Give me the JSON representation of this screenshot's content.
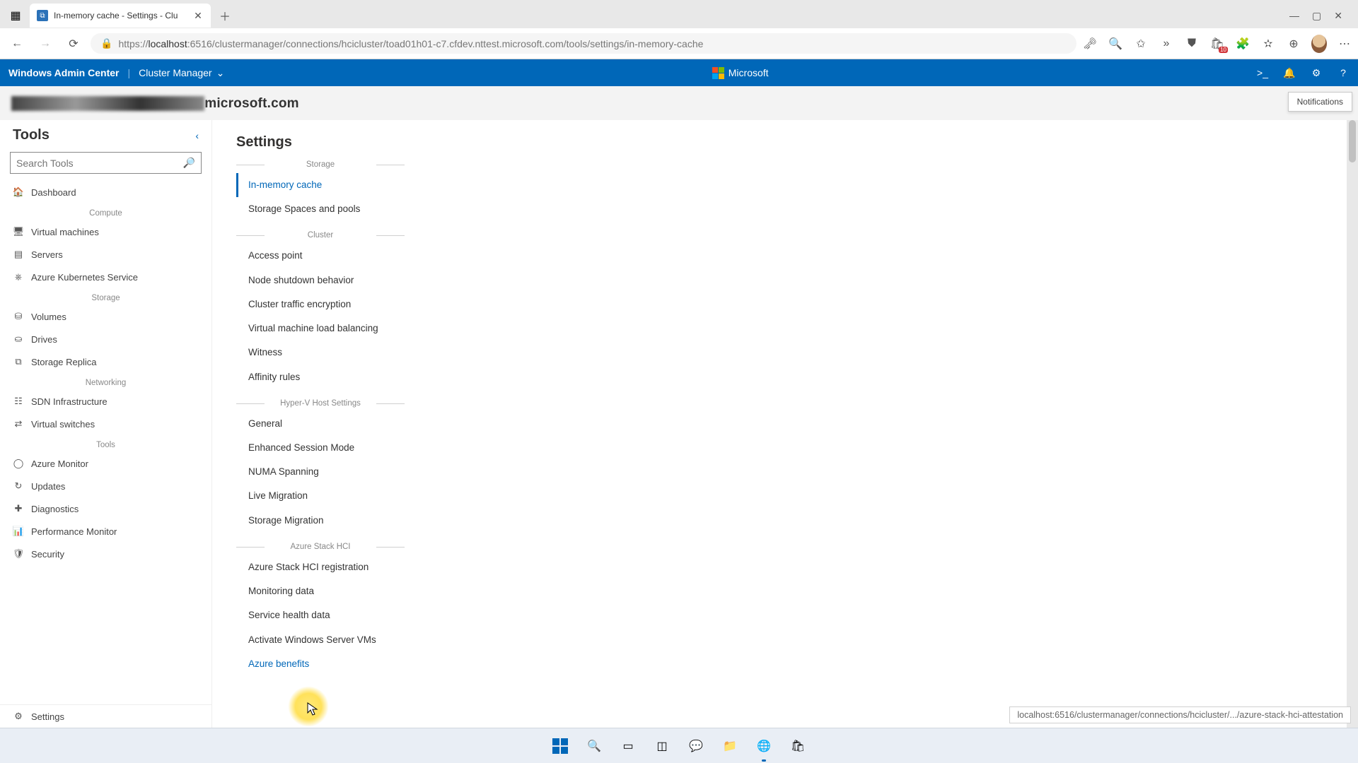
{
  "browser": {
    "tab_title": "In-memory cache - Settings - Clu",
    "url_prefix": "https://",
    "url_host": "localhost",
    "url_port": ":6516",
    "url_path": "/clustermanager/connections/hcicluster/toad01h01-c7.cfdev.nttest.microsoft.com/tools/settings/in-memory-cache",
    "collections_badge": "10"
  },
  "wac": {
    "brand": "Windows Admin Center",
    "context": "Cluster Manager",
    "ms_label": "Microsoft",
    "notif_tooltip": "Notifications"
  },
  "hostname_suffix": "microsoft.com",
  "tools": {
    "title": "Tools",
    "search_placeholder": "Search Tools",
    "groups": [
      {
        "name": "",
        "items": [
          {
            "icon": "🏠",
            "label": "Dashboard",
            "iconName": "home-icon",
            "itemName": "tool-dashboard"
          }
        ]
      },
      {
        "name": "Compute",
        "items": [
          {
            "icon": "🖥",
            "label": "Virtual machines",
            "iconName": "vm-icon",
            "itemName": "tool-virtual-machines"
          },
          {
            "icon": "▤",
            "label": "Servers",
            "iconName": "server-icon",
            "itemName": "tool-servers"
          },
          {
            "icon": "⎈",
            "label": "Azure Kubernetes Service",
            "iconName": "aks-icon",
            "itemName": "tool-aks"
          }
        ]
      },
      {
        "name": "Storage",
        "items": [
          {
            "icon": "⛁",
            "label": "Volumes",
            "iconName": "volume-icon",
            "itemName": "tool-volumes"
          },
          {
            "icon": "⛀",
            "label": "Drives",
            "iconName": "drive-icon",
            "itemName": "tool-drives"
          },
          {
            "icon": "⧉",
            "label": "Storage Replica",
            "iconName": "replica-icon",
            "itemName": "tool-storage-replica"
          }
        ]
      },
      {
        "name": "Networking",
        "items": [
          {
            "icon": "☷",
            "label": "SDN Infrastructure",
            "iconName": "sdn-icon",
            "itemName": "tool-sdn"
          },
          {
            "icon": "⇄",
            "label": "Virtual switches",
            "iconName": "vswitch-icon",
            "itemName": "tool-virtual-switches"
          }
        ]
      },
      {
        "name": "Tools",
        "items": [
          {
            "icon": "◯",
            "label": "Azure Monitor",
            "iconName": "monitor-icon",
            "itemName": "tool-azure-monitor"
          },
          {
            "icon": "↻",
            "label": "Updates",
            "iconName": "updates-icon",
            "itemName": "tool-updates"
          },
          {
            "icon": "✚",
            "label": "Diagnostics",
            "iconName": "diag-icon",
            "itemName": "tool-diagnostics"
          },
          {
            "icon": "📊",
            "label": "Performance Monitor",
            "iconName": "perf-icon",
            "itemName": "tool-perf-monitor"
          },
          {
            "icon": "🛡",
            "label": "Security",
            "iconName": "shield-icon",
            "itemName": "tool-security"
          }
        ]
      }
    ],
    "bottom": {
      "icon": "⚙",
      "label": "Settings",
      "iconName": "gear-icon",
      "itemName": "tool-settings"
    }
  },
  "settings": {
    "title": "Settings",
    "sections": [
      {
        "name": "Storage",
        "items": [
          {
            "label": "In-memory cache",
            "selected": true,
            "itemName": "setting-in-memory-cache"
          },
          {
            "label": "Storage Spaces and pools",
            "itemName": "setting-storage-spaces"
          }
        ]
      },
      {
        "name": "Cluster",
        "items": [
          {
            "label": "Access point",
            "itemName": "setting-access-point"
          },
          {
            "label": "Node shutdown behavior",
            "itemName": "setting-node-shutdown"
          },
          {
            "label": "Cluster traffic encryption",
            "itemName": "setting-traffic-encryption"
          },
          {
            "label": "Virtual machine load balancing",
            "itemName": "setting-vm-load-balancing"
          },
          {
            "label": "Witness",
            "itemName": "setting-witness"
          },
          {
            "label": "Affinity rules",
            "itemName": "setting-affinity"
          }
        ]
      },
      {
        "name": "Hyper-V Host Settings",
        "items": [
          {
            "label": "General",
            "itemName": "setting-hv-general"
          },
          {
            "label": "Enhanced Session Mode",
            "itemName": "setting-enhanced-session"
          },
          {
            "label": "NUMA Spanning",
            "itemName": "setting-numa"
          },
          {
            "label": "Live Migration",
            "itemName": "setting-live-migration"
          },
          {
            "label": "Storage Migration",
            "itemName": "setting-storage-migration"
          }
        ]
      },
      {
        "name": "Azure Stack HCI",
        "items": [
          {
            "label": "Azure Stack HCI registration",
            "itemName": "setting-hci-registration"
          },
          {
            "label": "Monitoring data",
            "itemName": "setting-monitoring-data"
          },
          {
            "label": "Service health data",
            "itemName": "setting-service-health"
          },
          {
            "label": "Activate Windows Server VMs",
            "itemName": "setting-activate-ws-vms"
          },
          {
            "label": "Azure benefits",
            "link": true,
            "itemName": "setting-azure-benefits"
          }
        ]
      }
    ]
  },
  "status_url": "localhost:6516/clustermanager/connections/hcicluster/.../azure-stack-hci-attestation"
}
